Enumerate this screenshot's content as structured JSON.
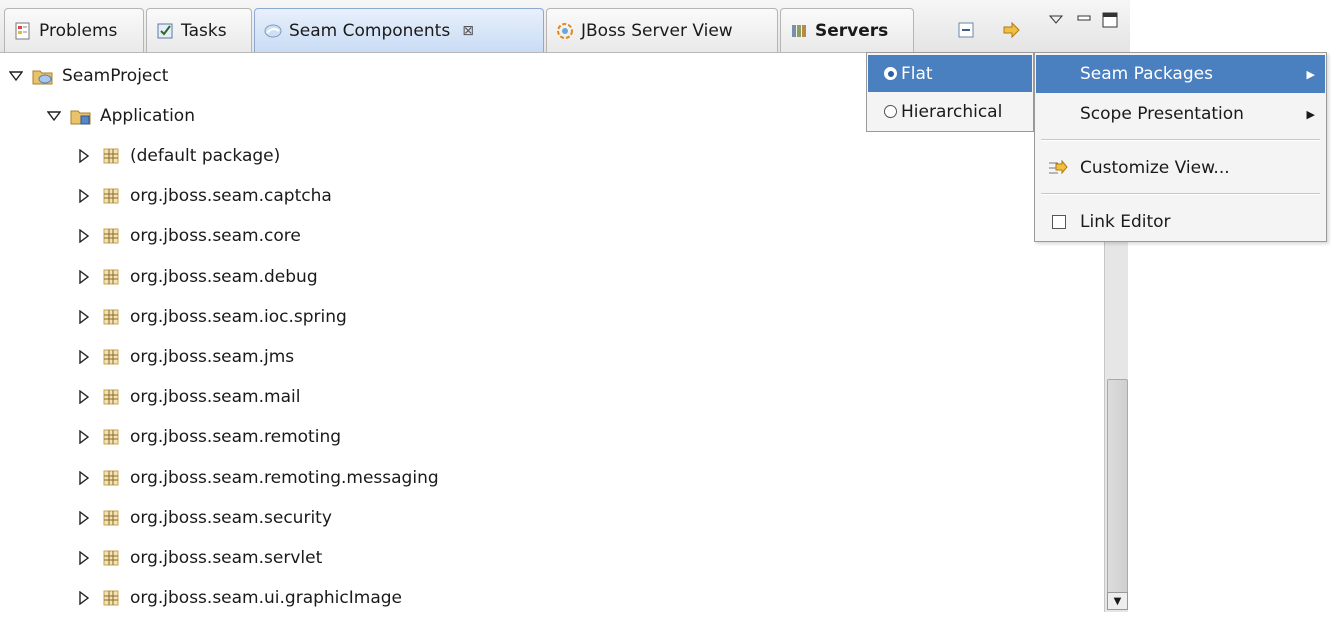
{
  "tabs": [
    {
      "label": "Problems",
      "icon": "problems-icon"
    },
    {
      "label": "Tasks",
      "icon": "tasks-icon"
    },
    {
      "label": "Seam Components",
      "icon": "seam-icon",
      "active": true,
      "close": "⊠"
    },
    {
      "label": "JBoss Server View",
      "icon": "jboss-icon"
    },
    {
      "label": "Servers",
      "icon": "servers-icon"
    }
  ],
  "toolbar": {
    "collapse_icon": "collapse-all-icon",
    "link_icon": "link-with-editor-icon",
    "menu_icon": "view-menu-icon",
    "minimize_icon": "minimize-icon",
    "maximize_icon": "maximize-icon"
  },
  "tree": {
    "project": "SeamProject",
    "scope": "Application",
    "packages": [
      "(default package)",
      "org.jboss.seam.captcha",
      "org.jboss.seam.core",
      "org.jboss.seam.debug",
      "org.jboss.seam.ioc.spring",
      "org.jboss.seam.jms",
      "org.jboss.seam.mail",
      "org.jboss.seam.remoting",
      "org.jboss.seam.remoting.messaging",
      "org.jboss.seam.security",
      "org.jboss.seam.servlet",
      "org.jboss.seam.ui.graphicImage"
    ]
  },
  "submenu": {
    "flat": "Flat",
    "hierarchical": "Hierarchical"
  },
  "menu": {
    "seam_packages": "Seam Packages",
    "scope_presentation": "Scope Presentation",
    "customize_view": "Customize View...",
    "link_editor": "Link Editor"
  },
  "colors": {
    "selection": "#4a7fc0",
    "package_icon": "#c9a24a"
  }
}
